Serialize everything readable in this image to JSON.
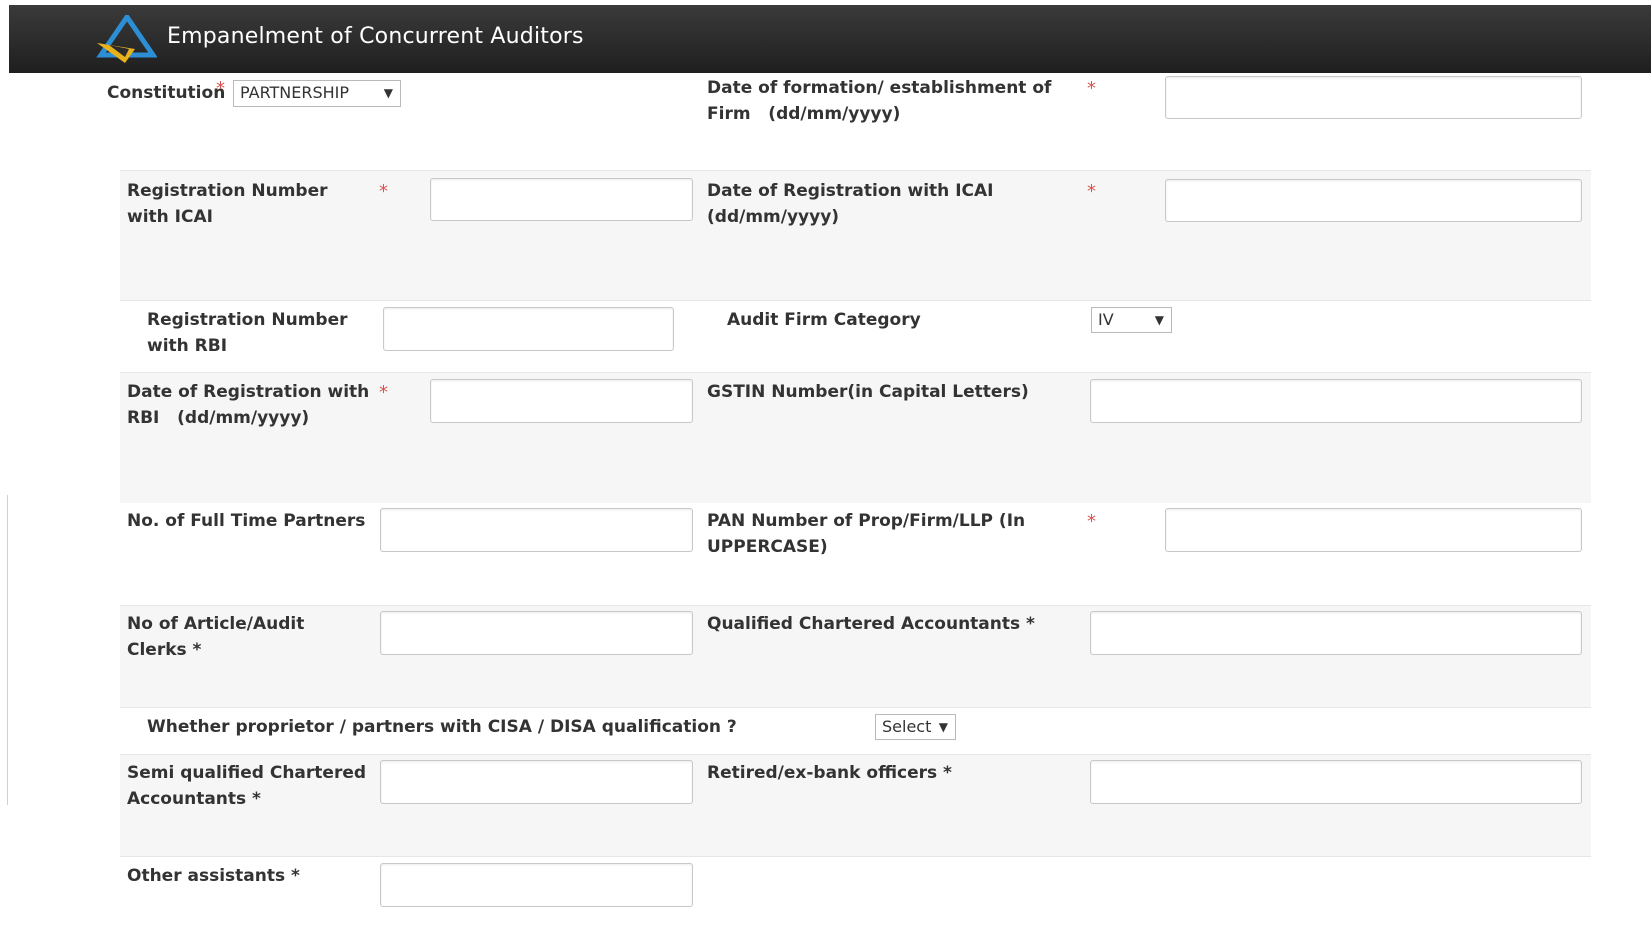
{
  "header": {
    "title": "Empanelment of Concurrent Auditors",
    "logo_icon": "sbi-logo-icon"
  },
  "colors": {
    "header_bg": "#2b2b2b",
    "required_star": "#d9534f",
    "band_bg": "#f6f6f6"
  },
  "required_mark": "*",
  "form": {
    "constitution": {
      "label": "Constitution",
      "value": "PARTNERSHIP"
    },
    "date_formation": {
      "label_line1": "Date of formation/ establishment of",
      "label_line2": "Firm   (dd/mm/yyyy)",
      "value": ""
    },
    "reg_icai": {
      "label_line1": "Registration Number",
      "label_line2": "with ICAI",
      "value": ""
    },
    "date_reg_icai": {
      "label_line1": "Date of Registration with ICAI",
      "label_line2": "(dd/mm/yyyy)",
      "value": ""
    },
    "reg_rbi": {
      "label_line1": "Registration Number",
      "label_line2": "with RBI",
      "value": ""
    },
    "audit_category": {
      "label": "Audit Firm Category",
      "value": "IV"
    },
    "date_reg_rbi": {
      "label_line1": "Date of Registration with",
      "label_line2": "RBI   (dd/mm/yyyy)",
      "value": ""
    },
    "gstin": {
      "label": "GSTIN Number(in Capital Letters)",
      "value": ""
    },
    "full_time_partners": {
      "label": "No. of Full Time Partners",
      "value": ""
    },
    "pan": {
      "label_line1": "PAN Number of Prop/Firm/LLP (In",
      "label_line2": "UPPERCASE)",
      "value": ""
    },
    "article_clerks": {
      "label_line1": "No of Article/Audit",
      "label_line2": "Clerks *",
      "value": ""
    },
    "qualified_ca": {
      "label": "Qualified Chartered Accountants *",
      "value": ""
    },
    "cisa_disa": {
      "label": "Whether proprietor / partners with CISA / DISA qualification ?",
      "value": "Select"
    },
    "semi_qualified": {
      "label_line1": "Semi qualified Chartered",
      "label_line2": "Accountants *",
      "value": ""
    },
    "retired_officers": {
      "label": "Retired/ex-bank officers *",
      "value": ""
    },
    "other_assistants": {
      "label": "Other assistants *",
      "value": ""
    }
  },
  "icons": {
    "dropdown_caret": "▼"
  }
}
